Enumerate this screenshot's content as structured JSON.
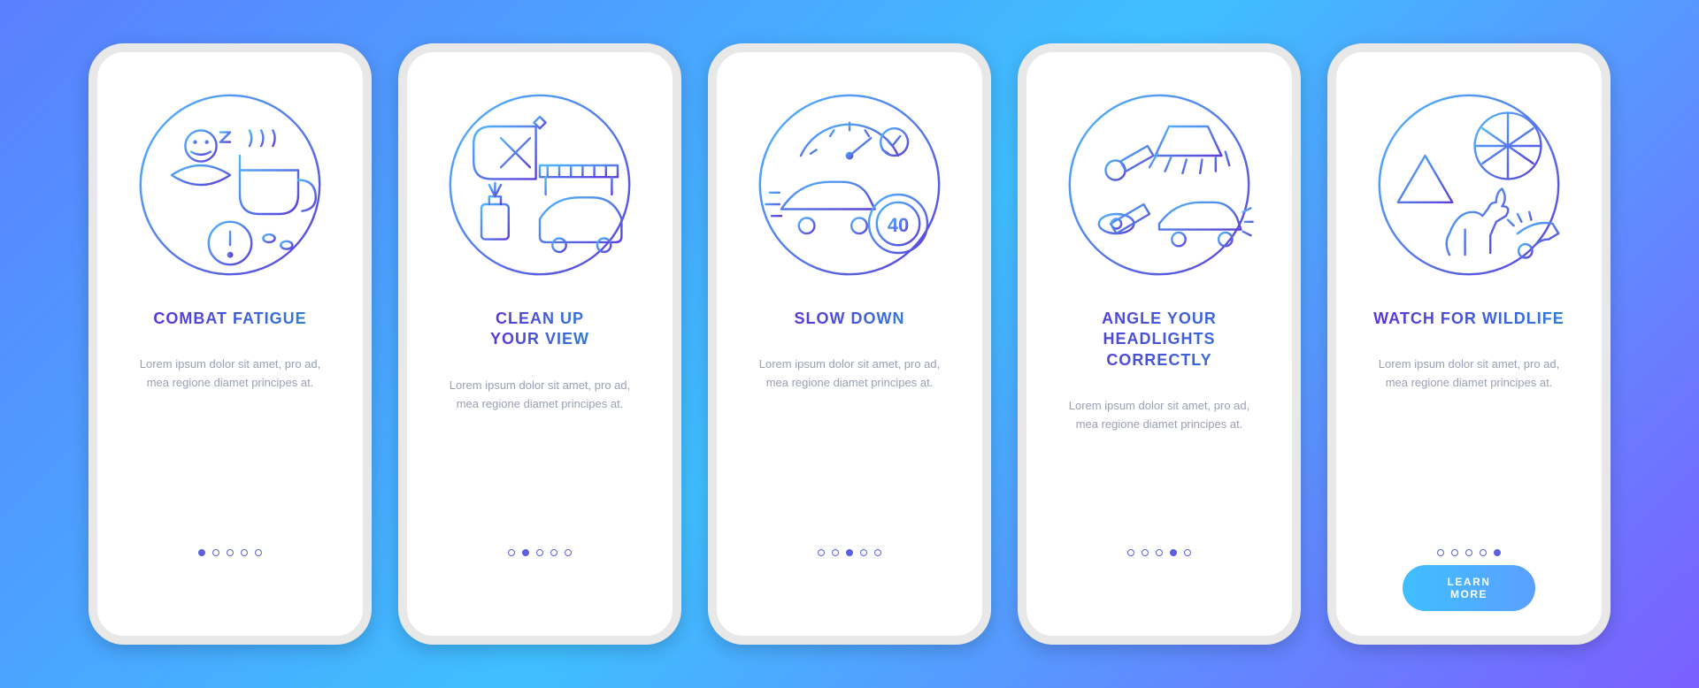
{
  "colors": {
    "grad_start": "#4FB8FF",
    "grad_end": "#5B3FD9"
  },
  "cta_label": "LEARN MORE",
  "body_text": "Lorem ipsum dolor sit amet, pro ad, mea regione diamet principes at.",
  "screens": [
    {
      "id": "combat-fatigue",
      "title": "COMBAT FATIGUE",
      "icon": "fatigue"
    },
    {
      "id": "clean-view",
      "title": "CLEAN UP\nYOUR VIEW",
      "icon": "clean"
    },
    {
      "id": "slow-down",
      "title": "SLOW DOWN",
      "icon": "slow"
    },
    {
      "id": "headlights",
      "title": "ANGLE YOUR\nHEADLIGHTS CORRECTLY",
      "icon": "headlights"
    },
    {
      "id": "wildlife",
      "title": "WATCH FOR WILDLIFE",
      "icon": "wildlife"
    }
  ]
}
